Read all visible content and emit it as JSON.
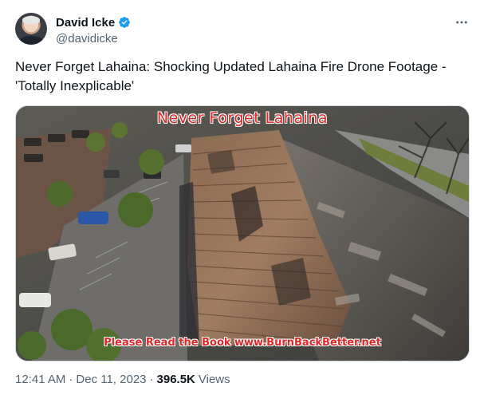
{
  "author": {
    "display_name": "David Icke",
    "handle": "@davidicke",
    "verified": true,
    "verified_color": "#1d9bf0"
  },
  "tweet": {
    "text": "Never Forget Lahaina: Shocking Updated Lahaina Fire Drone Footage - 'Totally Inexplicable'"
  },
  "media": {
    "overlay_top": "Never Forget Lahaina",
    "overlay_bottom": "Please Read the Book www.BurnBackBetter.net",
    "overlay_color": "#e0282a"
  },
  "meta": {
    "time": "12:41 AM",
    "separator": "·",
    "date": "Dec 11, 2023",
    "separator2": "·",
    "views_count": "396.5K",
    "views_label": "Views"
  },
  "icons": {
    "verified": "verified-badge-icon",
    "more": "more-options-icon"
  }
}
